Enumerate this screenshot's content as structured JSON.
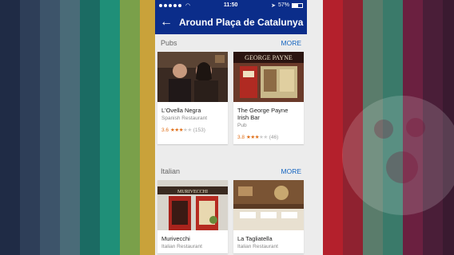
{
  "status": {
    "time": "11:50",
    "battery": "57%"
  },
  "appbar": {
    "title": "Around Plaça de Catalunya"
  },
  "sections": [
    {
      "title": "Pubs",
      "more": "MORE",
      "cards": [
        {
          "name": "L'Ovella Negra",
          "type": "Spanish Restaurant",
          "rating": "3.6",
          "stars": 3,
          "count": "(153)"
        },
        {
          "name": "The George Payne Irish Bar",
          "type": "Pub",
          "rating": "3.8",
          "stars": 3,
          "count": "(46)",
          "sign": "GEORGE PAYNE"
        }
      ]
    },
    {
      "title": "Italian",
      "more": "MORE",
      "cards": [
        {
          "name": "Murivecchi",
          "type": "Italian Restaurant",
          "sign": "MURIVECCHI"
        },
        {
          "name": "La Tagliatella",
          "type": "Italian Restaurant"
        }
      ]
    }
  ],
  "colors": {
    "accent": "#0b2d8a",
    "link": "#1565c0",
    "star": "#e0701a"
  }
}
